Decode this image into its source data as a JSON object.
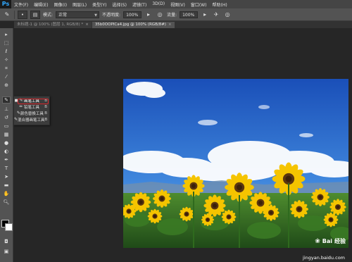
{
  "app": {
    "logo": "Ps"
  },
  "menu": [
    "文件(F)",
    "编辑(E)",
    "图像(I)",
    "图层(L)",
    "类型(Y)",
    "选择(S)",
    "滤镜(T)",
    "3D(D)",
    "视图(V)",
    "窗口(W)",
    "帮助(H)"
  ],
  "options": {
    "mode_label": "模式:",
    "mode_value": "正常",
    "opacity_label": "不透明度:",
    "opacity_value": "100%",
    "flow_label": "流量:",
    "flow_value": "100%"
  },
  "tabs": [
    {
      "label": "未标题-1 @ 100% (图层 1, RGB/8) *",
      "active": false
    },
    {
      "label": "35b0OOPICa4.jpg @ 100% (RGB/8#)",
      "active": true
    }
  ],
  "flyout": {
    "items": [
      {
        "label": "画笔工具",
        "key": "B",
        "selected": true
      },
      {
        "label": "铅笔工具",
        "key": "B",
        "selected": false
      },
      {
        "label": "颜色替换工具",
        "key": "B",
        "selected": false
      },
      {
        "label": "混合器画笔工具",
        "key": "B",
        "selected": false
      }
    ]
  },
  "watermark": {
    "brand": "Bai",
    "brand2": "经验",
    "url": "jingyan.baidu.com"
  },
  "colors": {
    "sky_top": "#1d5fc4",
    "sky_bottom": "#6aa5e6",
    "petal": "#f5c400",
    "leaf": "#3f7f2a"
  }
}
